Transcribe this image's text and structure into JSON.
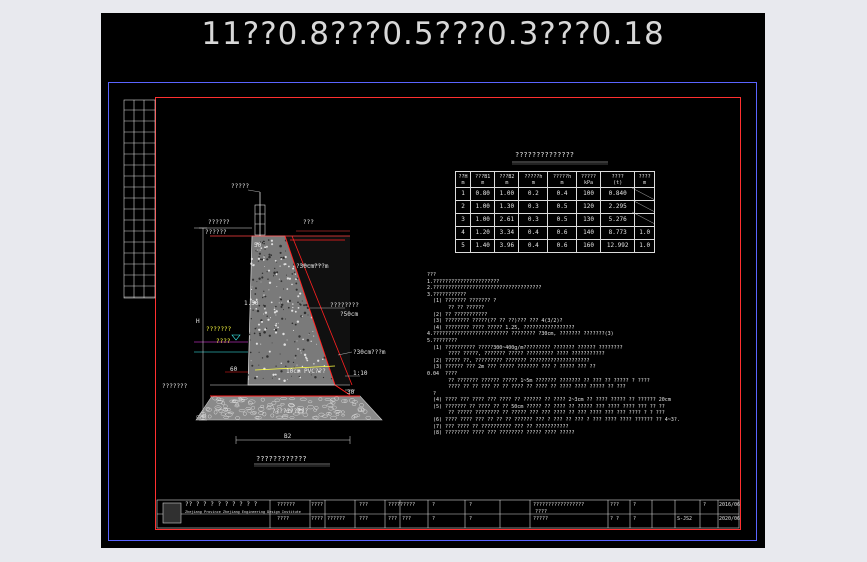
{
  "drawing": {
    "title": "11??0.8???0.5???0.3???0.18"
  },
  "param_table": {
    "title": "??????????????",
    "headers": [
      "??H\nm",
      "???B1\nm",
      "???B2\nm",
      "?????h\nm",
      "?????h\nm",
      "?????\nkPa",
      "????\n(t)",
      "????\nm"
    ],
    "rows": [
      [
        "1",
        "0.80",
        "1.00",
        "0.2",
        "0.4",
        "100",
        "0.840",
        ""
      ],
      [
        "2",
        "1.00",
        "1.30",
        "0.3",
        "0.5",
        "120",
        "2.295",
        ""
      ],
      [
        "3",
        "1.00",
        "2.61",
        "0.3",
        "0.5",
        "130",
        "5.276",
        ""
      ],
      [
        "4",
        "1.20",
        "3.34",
        "0.4",
        "0.6",
        "140",
        "8.773",
        "1.0"
      ],
      [
        "5",
        "1.40",
        "3.96",
        "0.4",
        "0.6",
        "160",
        "12.992",
        "1.0"
      ]
    ]
  },
  "section_labels": {
    "top_note": "?????",
    "left_top": "??????",
    "left_mid": "??????",
    "right_top": "???",
    "slope_note": "?30cm???m",
    "right_mid": "????????",
    "right_mid2": "?50cm",
    "right_low": "?30cm???m",
    "width_b": "B2",
    "height_h": "H",
    "water_level": "???????",
    "water_level2": "????",
    "pipe": "10cm PVC???",
    "ratio": "1:10",
    "mark_50": "50",
    "mark_60": "60",
    "mark_30": "30",
    "mark_150": "1.50",
    "foot": "??????????",
    "left_bottom": "???????",
    "caption": "????????????"
  },
  "notes": [
    "???",
    "1.??????????????????????",
    "2.????????????????????????????????????",
    "3.???????????",
    "  (1) ??????? ??????? ?",
    "       ?? ?? ??????",
    "  (2) ?? ???????????",
    "  (3) ???????? ?????(?? ?? ??)??? ??? 4(3/2)?",
    "  (4) ???????? ???? ????? 1.25, ?????????????????",
    "4.????????????????????????? ???????? ?30cm, ??????? ???????(3)",
    "5.????????",
    "  (1) ?????????? ?????300~400g/m????????? ??????? ?????? ????????",
    "       ???? ?????, ??????? ????? ????????? ???? ???????????",
    "  (2) ????? ??, ????????? ??????? ????????????????????",
    "  (3) ?????? ??? 2m ??? ????? ??????? ??? ? ????? ??? ??",
    "0.04  ????",
    "       ?? ??????? ?????? ????? 1~5m ??????? ??????? ?? ??? ?? ????? ? ????",
    "       ???? ?? ?? ??? ?? ?? ???? ?? ???? ?? ???? ???? ????? ?? ???",
    "  ?",
    "  (4) ???? ??? ???? ??? ???? ?? ?????? ?? ???? 2~3cm ?? ???? ????? ?? ?????? 20cm",
    "  (5) ??????? ?? ???? ?? ?? 50cm ????? ?? ???? ?? ????? ??? ???? ???? ??? ?? ??",
    "",
    "       ?? ????? ???????? ?? ????? ??? ??? ???? ?? ??? ???? ??? ??? ???? ? ? ???",
    "",
    "  (6) ???? ???? ??? ?? ?? ?? ?????? ??? ? ??? ?? ??? ? ??? ???? ???? ?????? ?? 4~3?.",
    "  (7) ??? ???? ?? ?????????? ??? ?? ???????????",
    "  (8) ???????? ???? ??? ???????? ????? ???? ?????"
  ],
  "title_block": {
    "company": "?? ? ? ? ? ? ? ? ? ?",
    "company_en": "Zhejiang Province Zhejiang Engineering Design Institute",
    "c1": "??????",
    "c2": "????",
    "c3": "????",
    "c4": "????",
    "c5": "??????",
    "c6": "???",
    "c7": "???",
    "c8": "?????????",
    "c9": "???",
    "c10": "???",
    "c11": "?",
    "c12": "?",
    "c13": "?",
    "c14": "?",
    "c15": "?????",
    "c16": "???",
    "c17": "? ?",
    "c18": "?",
    "c19": "?",
    "c20": "S-JS2",
    "c21": "?",
    "date1": "2016/06",
    "date2": "2020/06",
    "project": "?????????????????",
    "sheet": "????"
  },
  "colors": {
    "frame_red": "#ff3030",
    "frame_blue": "#5a64ff",
    "wall_fill": "#808080",
    "yellow": "#ffff40",
    "cyan": "#40ffff",
    "magenta": "#ff40ff",
    "red_line": "#ff2020"
  }
}
